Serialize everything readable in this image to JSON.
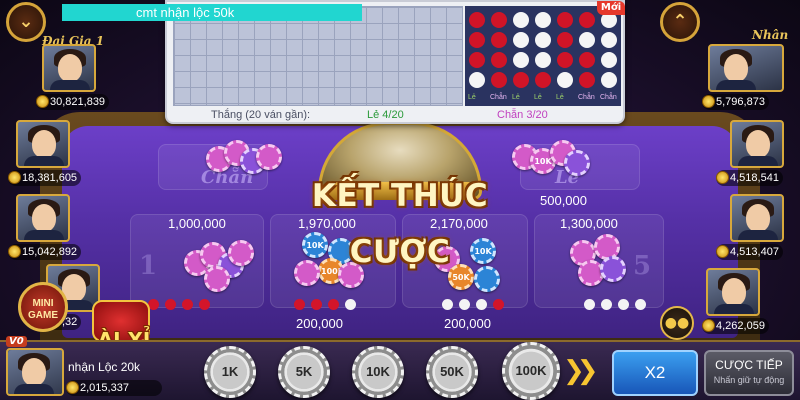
{
  "chat": {
    "message": "cmt nhận lộc 50k"
  },
  "history": {
    "new_badge": "Mới",
    "summary_label": "Thắng (20 ván gần):",
    "le_stat": "Lẻ  4/20",
    "chan_stat": "Chẵn  3/20",
    "bead_labels": [
      "Lẻ",
      "Chẵn",
      "Lẻ",
      "Lẻ",
      "Lẻ",
      "Chẵn",
      "Chẵn"
    ],
    "bead_rows": [
      [
        "red",
        "red",
        "white",
        "white",
        "red",
        "red",
        "white"
      ],
      [
        "red",
        "red",
        "white",
        "white",
        "red",
        "white",
        "white"
      ],
      [
        "red",
        "red",
        "white",
        "white",
        "red",
        "red",
        "white"
      ],
      [
        "white",
        "red",
        "red",
        "red",
        "white",
        "red",
        "white"
      ]
    ]
  },
  "table": {
    "headline": "KẾT THÚC CƯỢC",
    "chan_label": "Chẵn",
    "le_label": "Lẻ",
    "le_amount": "500,000",
    "bets": [
      {
        "amount": "1,000,000",
        "dots": [
          "red",
          "red",
          "red",
          "red"
        ]
      },
      {
        "amount": "1,970,000",
        "dots": [
          "red",
          "red",
          "red",
          "white"
        ]
      },
      {
        "amount": "2,170,000",
        "dots": [
          "white",
          "white",
          "white",
          "red"
        ]
      },
      {
        "amount": "1,300,000",
        "dots": [
          "white",
          "white",
          "white",
          "white"
        ]
      }
    ],
    "lower_amounts": [
      "200,000",
      "200,000"
    ],
    "chip_values": [
      "10K",
      "10K",
      "10K",
      "100K",
      "50K",
      "10K"
    ]
  },
  "top_left": {
    "title": "Đại Gia 1"
  },
  "top_right": {
    "title": "Nhân"
  },
  "players_left": [
    {
      "balance": "30,821,839"
    },
    {
      "balance": "18,381,605"
    },
    {
      "balance": "15,042,892"
    },
    {
      "balance": ",32"
    }
  ],
  "players_right": [
    {
      "balance": "5,796,873"
    },
    {
      "balance": "4,518,541"
    },
    {
      "balance": "4,513,407"
    },
    {
      "balance": "4,262,059"
    }
  ],
  "self": {
    "vip": "V0",
    "name": "nhận Lộc 20k",
    "balance": "2,015,337"
  },
  "mini_game": {
    "label_line1": "MINI",
    "label_line2": "GAME"
  },
  "taixiu": {
    "label": "ÀI XỈ"
  },
  "chips": [
    "1K",
    "5K",
    "10K",
    "50K",
    "100K"
  ],
  "buttons": {
    "x2": "X2",
    "rebet": "CƯỢC TIẾP",
    "rebet_hint": "Nhấn giữ tự động"
  },
  "colors": {
    "felt": "#5530a6",
    "red_bead": "#d01427",
    "accent_gold": "#d5a43a",
    "x2_blue": "#1856b8"
  },
  "icons": [
    "chevron-down-icon",
    "chevron-up-icon",
    "double-arrow-icon",
    "group-icon",
    "coin-icon"
  ]
}
